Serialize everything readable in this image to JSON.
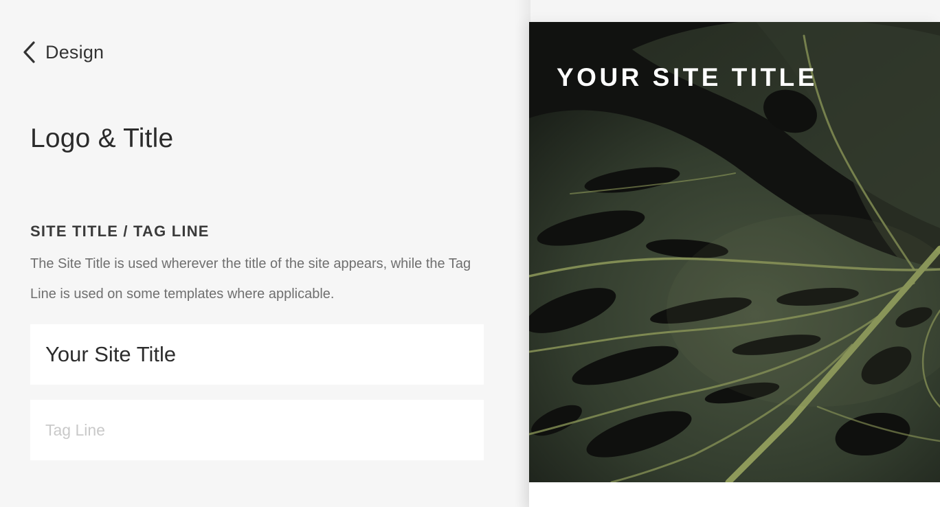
{
  "panel": {
    "back_label": "Design",
    "title": "Logo & Title",
    "section_heading": "SITE TITLE / TAG LINE",
    "section_description": "The Site Title is used wherever the title of the site appears, while the Tag Line is used on some templates where applicable.",
    "site_title_value": "Your Site Title",
    "tag_line_value": "",
    "tag_line_placeholder": "Tag Line"
  },
  "preview": {
    "site_title": "YOUR SITE TITLE",
    "hero_image": "monstera-leaf-photo"
  },
  "colors": {
    "panel_background": "#f6f6f6",
    "field_background": "#ffffff",
    "hero_title": "#ffffff",
    "leaf_dark": "#2f3a2a",
    "leaf_vein": "#8f9a5c"
  },
  "icons": {
    "back": "chevron-left-icon"
  }
}
